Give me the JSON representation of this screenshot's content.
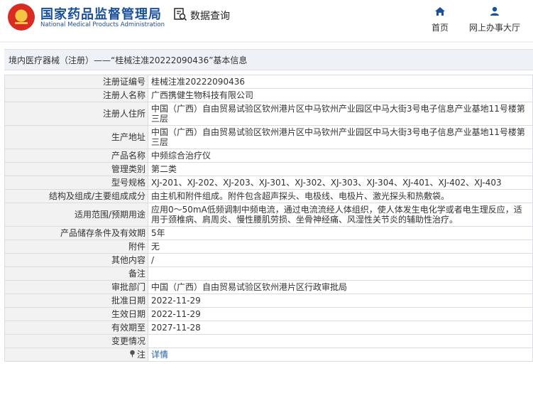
{
  "header": {
    "site_name_cn": "国家药品监督管理局",
    "site_name_en": "National Medical Products Administration",
    "query_label": "数据查询",
    "nav": [
      {
        "label": "首页",
        "icon": "home-icon"
      },
      {
        "label": "网上办事大厅",
        "icon": "user-icon"
      }
    ]
  },
  "title_bar": {
    "text": "境内医疗器械（注册）——“桂械注准20222090436”基本信息"
  },
  "table": {
    "rows": [
      {
        "label": "注册证编号",
        "value": "桂械注准20222090436"
      },
      {
        "label": "注册人名称",
        "value": "广西携健生物科技有限公司"
      },
      {
        "label": "注册人住所",
        "value": "中国（广西）自由贸易试验区钦州港片区中马钦州产业园区中马大街3号电子信息产业基地11号楼第三层"
      },
      {
        "label": "生产地址",
        "value": "中国（广西）自由贸易试验区钦州港片区中马钦州产业园区中马大街3号电子信息产业基地11号楼第三层"
      },
      {
        "label": "产品名称",
        "value": "中频综合治疗仪"
      },
      {
        "label": "管理类别",
        "value": "第二类"
      },
      {
        "label": "型号规格",
        "value": "XJ-201、XJ-202、XJ-203、XJ-301、XJ-302、XJ-303、XJ-304、XJ-401、XJ-402、XJ-403"
      },
      {
        "label": "结构及组成/主要组成成分",
        "value": "由主机和附件组成。附件包含超声探头、电极线、电极片、激光探头和热敷袋。"
      },
      {
        "label": "适用范围/预期用途",
        "value": "应用0～50mA低频调制中频电流，通过电流流经人体组织，使人体发生电化学或者电生理反应，适用于颈椎病、肩周炎、慢性腰肌劳损、坐骨神经痛、风湿性关节炎的辅助性治疗。"
      },
      {
        "label": "产品储存条件及有效期",
        "value": "5年"
      },
      {
        "label": "附件",
        "value": "无"
      },
      {
        "label": "其他内容",
        "value": "/"
      },
      {
        "label": "备注",
        "value": ""
      },
      {
        "label": "审批部门",
        "value": "中国（广西）自由贸易试验区钦州港片区行政审批局"
      },
      {
        "label": "批准日期",
        "value": "2022-11-29"
      },
      {
        "label": "生效日期",
        "value": "2022-11-29"
      },
      {
        "label": "有效期至",
        "value": "2027-11-28"
      },
      {
        "label": "变更情况",
        "value": ""
      },
      {
        "label": "注",
        "value": "详情"
      }
    ]
  },
  "colors": {
    "brand_blue": "#1a4f9c",
    "link_blue": "#1f5fae",
    "label_bg": "#f2f2f2",
    "border": "#d9dde3"
  }
}
